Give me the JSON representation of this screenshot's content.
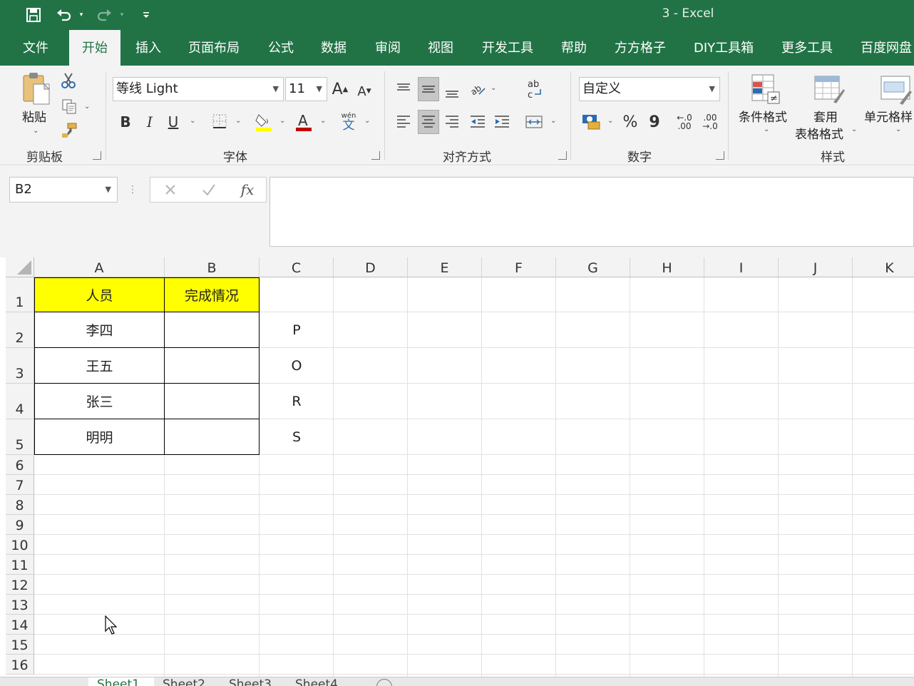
{
  "window": {
    "title": "3  -  Excel"
  },
  "tabs": [
    "文件",
    "开始",
    "插入",
    "页面布局",
    "公式",
    "数据",
    "审阅",
    "视图",
    "开发工具",
    "帮助",
    "方方格子",
    "DIY工具箱",
    "更多工具",
    "百度网盘"
  ],
  "ribbon": {
    "clipboard": {
      "paste_label": "粘贴",
      "group": "剪贴板"
    },
    "font": {
      "name": "等线 Light",
      "size": "11",
      "group": "字体",
      "bold": "B",
      "italic": "I",
      "underline": "U",
      "phonetic_top": "wén",
      "phonetic_bottom": "文"
    },
    "alignment": {
      "group": "对齐方式"
    },
    "number": {
      "format": "自定义",
      "group": "数字",
      "percent": "%",
      "comma": "9",
      "inc_decimal": "←.0\n.00",
      "dec_decimal": ".00\n→.0"
    },
    "styles": {
      "conditional": "条件格式",
      "table_line1": "套用",
      "table_line2": "表格格式",
      "cell_styles": "单元格样",
      "group": "样式"
    }
  },
  "formula_bar": {
    "name_box": "B2",
    "fx": "fx",
    "formula": ""
  },
  "columns": [
    "A",
    "B",
    "C",
    "D",
    "E",
    "F",
    "G",
    "H",
    "I",
    "J",
    "K"
  ],
  "rows": [
    "1",
    "2",
    "3",
    "4",
    "5",
    "6",
    "7",
    "8",
    "9",
    "10",
    "11",
    "12",
    "13",
    "14",
    "15",
    "16"
  ],
  "cells": {
    "A1": "人员",
    "B1": "完成情况",
    "A2": "李四",
    "A3": "王五",
    "A4": "张三",
    "A5": "明明",
    "C2": "P",
    "C3": "O",
    "C4": "R",
    "C5": "S"
  },
  "header_fill": "#ffff00",
  "sheets": [
    "Sheet1",
    "Sheet2",
    "Sheet3",
    "Sheet4"
  ]
}
